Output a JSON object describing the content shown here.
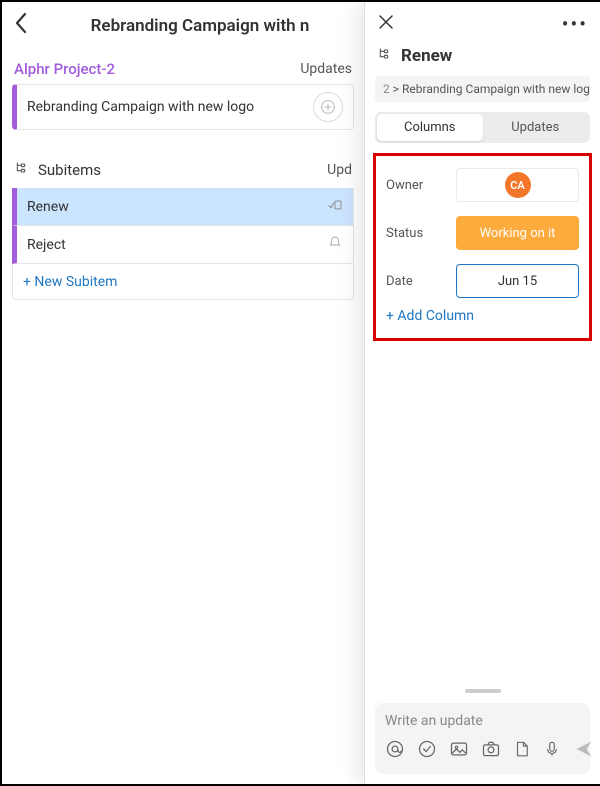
{
  "left": {
    "title": "Rebranding Campaign with n",
    "group_name": "Alphr Project-2",
    "updates_header": "Updates",
    "task": "Rebranding Campaign with new logo",
    "subitems_label": "Subitems",
    "subitems_updates": "Upd",
    "subitems": [
      {
        "name": "Renew",
        "selected": true
      },
      {
        "name": "Reject",
        "selected": false
      }
    ],
    "new_subitem": "+ New Subitem"
  },
  "right": {
    "title": "Renew",
    "breadcrumb_num": "2",
    "breadcrumb_text": "Rebranding Campaign with new logo",
    "tabs": {
      "columns": "Columns",
      "updates": "Updates",
      "active": "columns"
    },
    "columns": {
      "owner_label": "Owner",
      "owner_initials": "CA",
      "status_label": "Status",
      "status_value": "Working on it",
      "date_label": "Date",
      "date_value": "Jun 15"
    },
    "add_column": "+ Add Column",
    "compose_placeholder": "Write an update",
    "colors": {
      "accent_purple": "#a25ddc",
      "owner_badge": "#f4762a",
      "status_bg": "#fdab3d",
      "link_blue": "#1f76c2",
      "highlight_red": "#d80000"
    }
  }
}
